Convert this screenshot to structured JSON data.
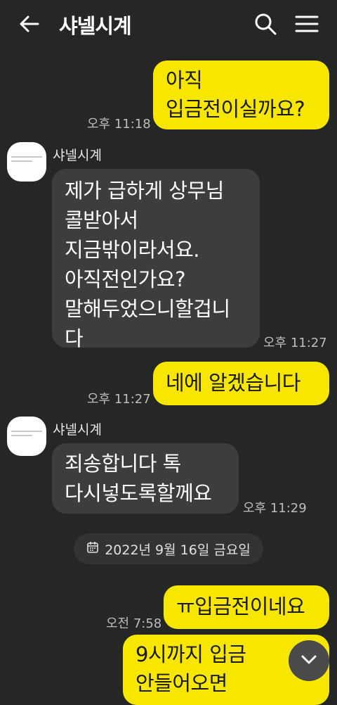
{
  "header": {
    "title": "샤넬시계"
  },
  "icons": {
    "back": "arrow-left-icon",
    "search": "search-icon",
    "menu": "hamburger-menu-icon",
    "scroll": "chevron-down-icon"
  },
  "colors": {
    "my_bubble": "#f7e600",
    "other_bubble": "#3d3d3d",
    "background": "#262626"
  },
  "messages": [
    {
      "sender": "me",
      "lines": [
        "아직",
        "입금전이실까요?"
      ],
      "time": "오후 11:18"
    },
    {
      "sender": "샤넬시계",
      "lines": [
        "제가 급하게 상무님",
        "콜받아서",
        "지금밖이라서요.",
        "아직전인가요?",
        "말해두었으니할겁니",
        "다"
      ],
      "time": "오후 11:27"
    },
    {
      "sender": "me",
      "lines": [
        "네에 알겠습니다"
      ],
      "time": "오후 11:27"
    },
    {
      "sender": "샤넬시계",
      "lines": [
        "죄송합니다 톡",
        "다시넣도록할께요"
      ],
      "time": "오후 11:29"
    },
    {
      "sender": "me",
      "lines": [
        "ㅠ입금전이네요"
      ],
      "time": "오전 7:58"
    },
    {
      "sender": "me",
      "lines": [
        "9시까지 입금",
        "안들어오면"
      ]
    }
  ],
  "date_divider": "2022년 9월 16일 금요일"
}
